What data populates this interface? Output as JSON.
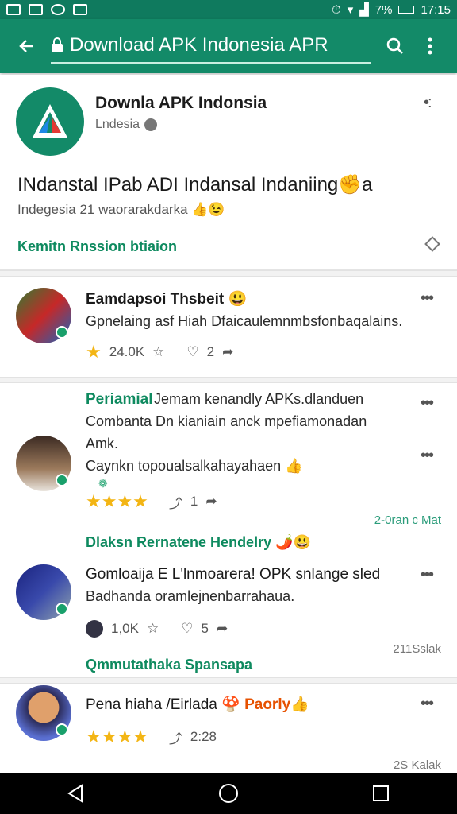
{
  "status_bar": {
    "battery": "7%",
    "time": "17:15"
  },
  "app_bar": {
    "url": "Download APK Indonesia APR"
  },
  "app_card": {
    "title": "Downla APK Indonsia",
    "subtitle": "Lndesia",
    "headline": "INdanstal IPab ADI Indansal Indaniing",
    "headline_emoji": "✊",
    "headline_tail": "a",
    "subline": "Indegesia 21 waorarakdarka",
    "subline_emoji": "👍😉",
    "link": "Kemitn Rnssion btiaion"
  },
  "reviews": [
    {
      "name": "Eamdapsoi Thsbeit",
      "name_emoji": "😃",
      "text": "Gpnelaing asf Hiah Dfaicaulemnmbsfonbaqalains.",
      "stat": "24.0K",
      "reply_count": "2",
      "meta": ""
    },
    {
      "name": "Periamial",
      "text_lines": [
        "Jemam kenandly APKs.dlanduen",
        "Combanta Dn kianiain anck mpefiamonadan",
        "Amk.",
        "Caynkn topoualsalkahayahaen"
      ],
      "text_emoji": "👍",
      "stars": 4,
      "reply_count": "1",
      "meta": "2-0ran c Mat"
    },
    {
      "name": "Dlaksn Rernatene Hendelry",
      "name_emoji": "🌶️😃",
      "name2": "Gomloaija E L'lnmoarera! OPK snlange sled",
      "text": "Badhanda oramlejnenbarrahaua.",
      "stat": "1,0K",
      "reply_count": "5",
      "meta": "211Sslak"
    },
    {
      "name": "Qmmutathaka Spansapa",
      "name2": "Pena hiaha /Eirlada",
      "name2_emoji": "🍄",
      "name2_tail": "Paorly",
      "name2_tail_emoji": "👍",
      "stars": 4,
      "reply_count": "2:28",
      "meta": "2S Kalak"
    }
  ],
  "colors": {
    "primary": "#138a68",
    "accent": "#0e8a5f",
    "star": "#f3b514"
  }
}
